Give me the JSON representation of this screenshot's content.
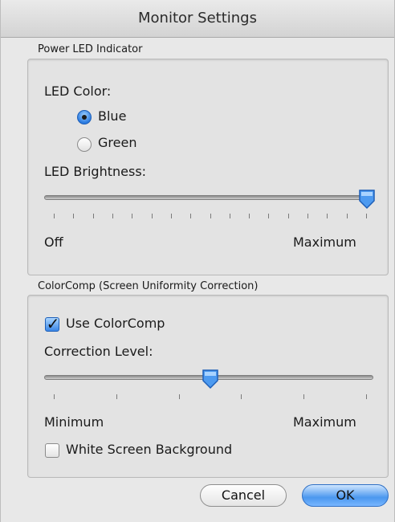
{
  "window": {
    "title": "Monitor Settings"
  },
  "power_led": {
    "section_title": "Power LED Indicator",
    "color_label": "LED Color:",
    "options": [
      {
        "label": "Blue",
        "selected": true
      },
      {
        "label": "Green",
        "selected": false
      }
    ],
    "brightness_label": "LED Brightness:",
    "brightness_value": 1.0,
    "brightness_ticks": 17,
    "min_label": "Off",
    "max_label": "Maximum"
  },
  "colorcomp": {
    "section_title": "ColorComp (Screen Uniformity Correction)",
    "use_label": "Use ColorComp",
    "use_checked": true,
    "level_label": "Correction Level:",
    "level_value": 0.5,
    "level_ticks": 6,
    "min_label": "Minimum",
    "max_label": "Maximum",
    "white_bg_label": "White Screen Background",
    "white_bg_checked": false
  },
  "buttons": {
    "cancel": "Cancel",
    "ok": "OK"
  },
  "colors": {
    "accent": "#3a86e6",
    "track": "#8a8a8a"
  }
}
